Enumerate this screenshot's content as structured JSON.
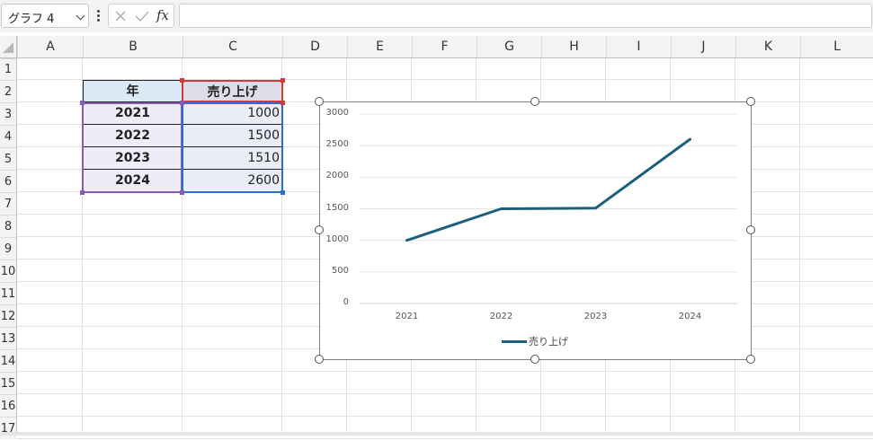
{
  "name_box": {
    "value": "グラフ 4",
    "icon": "chevron-down-icon"
  },
  "formula_bar": {
    "fx_label": "fx",
    "content": ""
  },
  "columns": [
    "A",
    "B",
    "C",
    "D",
    "E",
    "F",
    "G",
    "H",
    "I",
    "J",
    "K",
    "L"
  ],
  "rows": [
    "1",
    "2",
    "3",
    "4",
    "5",
    "6",
    "7",
    "8",
    "9",
    "10",
    "11",
    "12",
    "13",
    "14",
    "15",
    "16",
    "17"
  ],
  "table": {
    "headers": {
      "year": "年",
      "sales": "売り上げ"
    },
    "rows": [
      {
        "year": "2021",
        "sales": "1000"
      },
      {
        "year": "2022",
        "sales": "1500"
      },
      {
        "year": "2023",
        "sales": "1510"
      },
      {
        "year": "2024",
        "sales": "2600"
      }
    ]
  },
  "colors": {
    "line": "#1c5f7c",
    "year_header_bg": "#dbe8f5",
    "sales_header_bg": "#dcdde8",
    "year_sel": "#8a5ab8",
    "sales_sel": "#2e6bd3",
    "header_sel": "#d03a3a"
  },
  "chart_data": {
    "type": "line",
    "categories": [
      "2021",
      "2022",
      "2023",
      "2024"
    ],
    "series": [
      {
        "name": "売り上げ",
        "values": [
          1000,
          1500,
          1510,
          2600
        ]
      }
    ],
    "ylim": [
      0,
      3000
    ],
    "yticks": [
      "0",
      "500",
      "1000",
      "1500",
      "2000",
      "2500",
      "3000"
    ],
    "grid": true,
    "legend": "bottom"
  }
}
